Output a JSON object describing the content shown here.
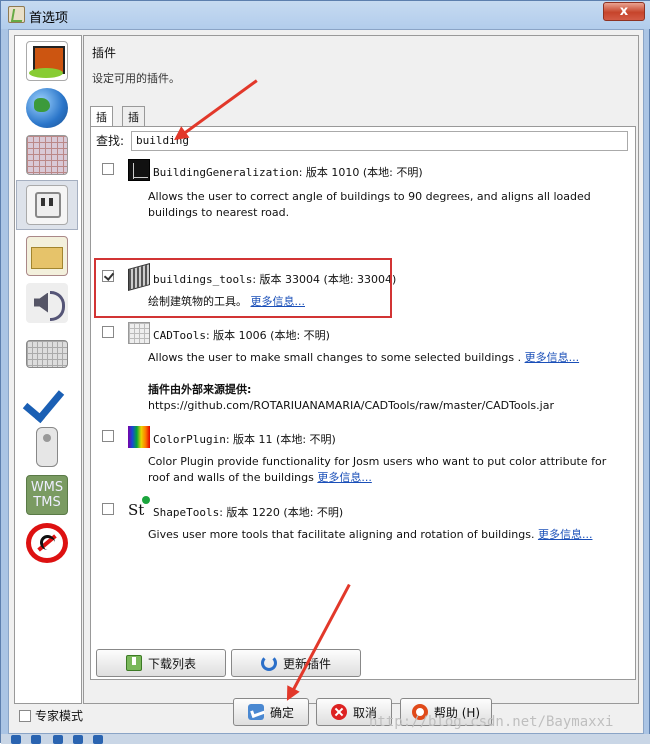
{
  "window": {
    "title": "首选项",
    "close_label": "x"
  },
  "panel": {
    "heading": "插件",
    "description": "设定可用的插件。",
    "tabs": [
      {
        "label": "插件"
      },
      {
        "label": "插件更新规则"
      }
    ],
    "search": {
      "label": "查找:",
      "value": "building"
    }
  },
  "plugins": [
    {
      "name": "BuildingGeneralization",
      "version": ": 版本 1010 (本地: 不明)",
      "description": "Allows the user to correct angle of buildings to 90 degrees, and aligns all loaded buildings to nearest road.",
      "more_link": "",
      "checked": false,
      "icon": "building-generalization-icon"
    },
    {
      "name": "buildings_tools",
      "version": ": 版本 33004 (本地: 33004)",
      "description": "绘制建筑物的工具。",
      "more_link": "更多信息...",
      "checked": true,
      "icon": "buildings-tools-icon"
    },
    {
      "name": "CADTools",
      "version": ": 版本 1006 (本地: 不明)",
      "description": "Allows the user to make small changes to some selected buildings .",
      "more_link": "更多信息...",
      "source_label": "插件由外部来源提供:",
      "source_url": "https://github.com/ROTARIUANAMARIA/CADTools/raw/master/CADTools.jar",
      "checked": false,
      "icon": "cadtools-icon"
    },
    {
      "name": "ColorPlugin",
      "version": ": 版本 11 (本地: 不明)",
      "description": "Color Plugin provide functionality for Josm users who want to put color attribute for roof and walls of the buildings",
      "more_link": "更多信息...",
      "checked": false,
      "icon": "color-plugin-icon"
    },
    {
      "name": "ShapeTools",
      "version": ": 版本 1220 (本地: 不明)",
      "description": "Gives user more tools that facilitate aligning and rotation of buildings.",
      "more_link": "更多信息...",
      "checked": false,
      "icon": "shape-tools-icon"
    }
  ],
  "icons": {
    "shape_tools_text": "St",
    "wms_line1": "WMS",
    "wms_line2": "TMS"
  },
  "panel_buttons": {
    "download_list": "下载列表",
    "update_plugins": "更新插件"
  },
  "dialog_buttons": {
    "ok": "确定",
    "cancel": "取消",
    "help": "帮助 (H)"
  },
  "expert_mode": {
    "label": "专家模式"
  },
  "watermark": "http://blog.csdn.net/Baymaxxi",
  "colors": {
    "highlight": "#d23434",
    "link": "#1a4fb8",
    "titlebar": "#b2cdec"
  }
}
